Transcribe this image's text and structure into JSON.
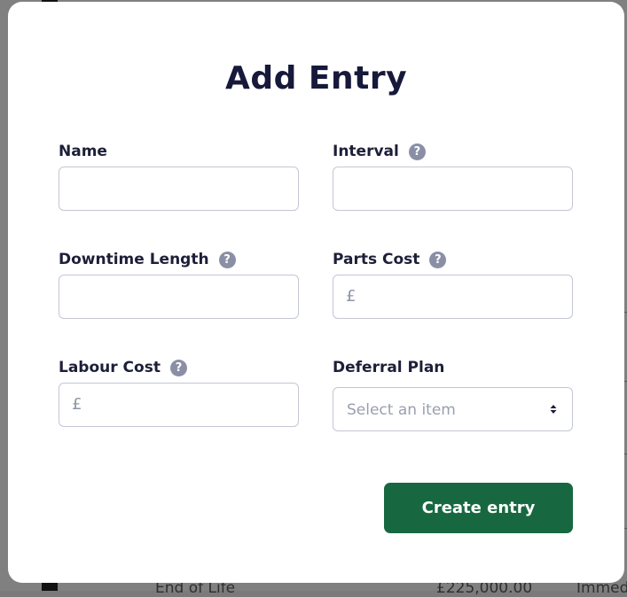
{
  "background": {
    "footer_row_label": "End of Life",
    "footer_row_value": "£225,000.00",
    "footer_row_status": "Immed"
  },
  "modal": {
    "title": "Add Entry",
    "fields": {
      "name": {
        "label": "Name",
        "value": ""
      },
      "interval": {
        "label": "Interval",
        "value": ""
      },
      "downtime_length": {
        "label": "Downtime Length",
        "value": ""
      },
      "parts_cost": {
        "label": "Parts Cost",
        "prefix": "£",
        "value": ""
      },
      "labour_cost": {
        "label": "Labour Cost",
        "prefix": "£",
        "value": ""
      },
      "deferral_plan": {
        "label": "Deferral Plan",
        "selected": "Select an item"
      }
    },
    "help_glyph": "?",
    "create_button_label": "Create entry"
  },
  "colors": {
    "primary_button": "#176840",
    "title_text": "#16193a",
    "help_icon": "#8b8fa6",
    "input_border": "#c4c7d3"
  }
}
